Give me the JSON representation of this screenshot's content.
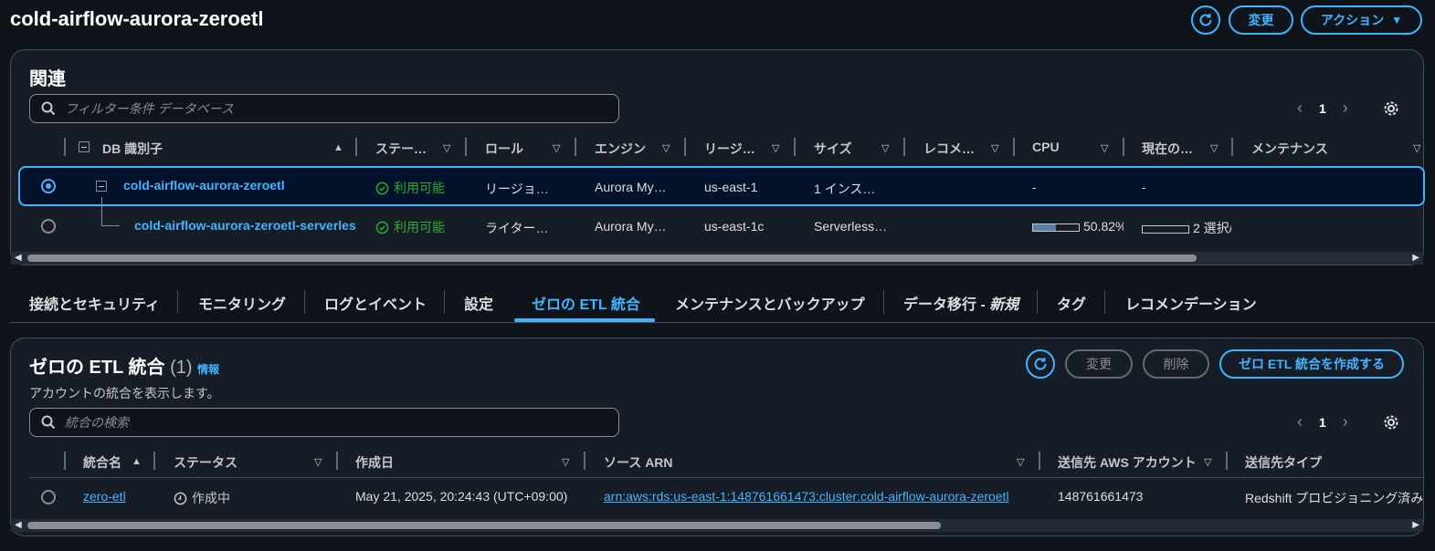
{
  "header": {
    "title": "cold-airflow-aurora-zeroetl",
    "modify_label": "変更",
    "actions_label": "アクション",
    "refresh_icon": "refresh-icon"
  },
  "related": {
    "heading": "関連",
    "filter_placeholder": "フィルター条件 データベース",
    "page": "1",
    "columns": [
      "DB 識別子",
      "ステー…",
      "ロール",
      "エンジン",
      "リージ…",
      "サイズ",
      "レコメ…",
      "CPU",
      "現在の…",
      "メンテナンス"
    ],
    "rows": [
      {
        "id": "cold-airflow-aurora-zeroetl",
        "status": "利用可能",
        "role": "リージョ…",
        "engine": "Aurora My…",
        "region": "us-east-1",
        "size": "1 インス…",
        "cpu": "-",
        "current": "-"
      },
      {
        "id": "cold-airflow-aurora-zeroetl-serverles",
        "status": "利用可能",
        "role": "ライター…",
        "engine": "Aurora My…",
        "region": "us-east-1c",
        "size": "Serverless…",
        "cpu": "50.82%",
        "cpu_fraction": 0.5082,
        "current": "2 選択/"
      }
    ]
  },
  "tabs": [
    {
      "label": "接続とセキュリティ"
    },
    {
      "label": "モニタリング"
    },
    {
      "label": "ログとイベント"
    },
    {
      "label": "設定"
    },
    {
      "label": "ゼロの ETL 統合",
      "active": true
    },
    {
      "label": "メンテナンスとバックアップ"
    },
    {
      "label": "データ移行 - ",
      "suffix": "新規"
    },
    {
      "label": "タグ"
    },
    {
      "label": "レコメンデーション"
    }
  ],
  "zero_etl": {
    "heading": "ゼロの ETL 統合",
    "count": "(1)",
    "info": "情報",
    "description": "アカウントの統合を表示します。",
    "modify_label": "変更",
    "delete_label": "削除",
    "create_label": "ゼロ ETL 統合を作成する",
    "search_placeholder": "統合の検索",
    "page": "1",
    "columns": [
      "統合名",
      "ステータス",
      "作成日",
      "ソース ARN",
      "送信先 AWS アカウント",
      "送信先タイプ"
    ],
    "rows": [
      {
        "name": "zero-etl",
        "status": "作成中",
        "created": "May 21, 2025, 20:24:43 (UTC+09:00)",
        "source_arn": "arn:aws:rds:us-east-1:148761661473:cluster:cold-airflow-aurora-zeroetl",
        "account": "148761661473",
        "target_type": "Redshift プロビジョニング済み"
      }
    ]
  },
  "colors": {
    "accent": "#42b4ff",
    "success": "#29ad32",
    "background": "#0f141a",
    "panel": "#161d26"
  }
}
